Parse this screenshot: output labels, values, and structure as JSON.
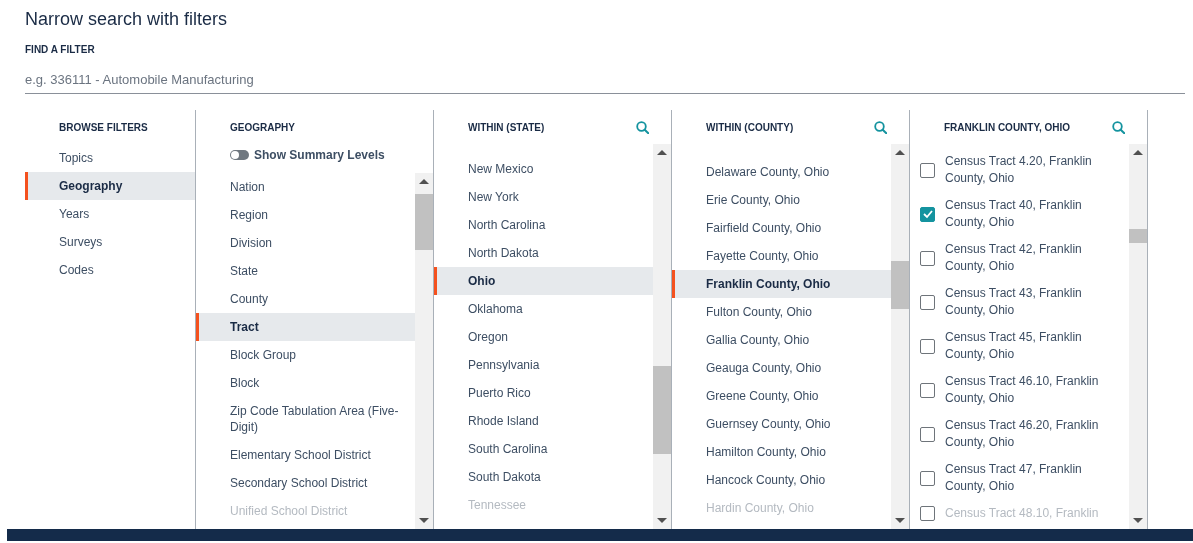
{
  "page": {
    "title": "Narrow search with filters"
  },
  "search": {
    "label": "FIND A FILTER",
    "placeholder": "e.g. 336111 - Automobile Manufacturing"
  },
  "browse": {
    "heading": "BROWSE FILTERS",
    "items": [
      {
        "label": "Topics",
        "selected": false
      },
      {
        "label": "Geography",
        "selected": true
      },
      {
        "label": "Years",
        "selected": false
      },
      {
        "label": "Surveys",
        "selected": false
      },
      {
        "label": "Codes",
        "selected": false
      }
    ]
  },
  "geography": {
    "heading": "GEOGRAPHY",
    "toggle": {
      "label": "Show Summary Levels",
      "on": false
    },
    "items": [
      {
        "label": "Nation",
        "selected": false
      },
      {
        "label": "Region",
        "selected": false
      },
      {
        "label": "Division",
        "selected": false
      },
      {
        "label": "State",
        "selected": false
      },
      {
        "label": "County",
        "selected": false
      },
      {
        "label": "Tract",
        "selected": true
      },
      {
        "label": "Block Group",
        "selected": false
      },
      {
        "label": "Block",
        "selected": false
      },
      {
        "label": "Zip Code Tabulation Area (Five-Digit)",
        "selected": false
      },
      {
        "label": "Elementary School District",
        "selected": false
      },
      {
        "label": "Secondary School District",
        "selected": false
      },
      {
        "label": "Unified School District",
        "selected": false
      }
    ]
  },
  "state": {
    "heading": "WITHIN (STATE)",
    "items": [
      {
        "label": "New Mexico",
        "selected": false
      },
      {
        "label": "New York",
        "selected": false
      },
      {
        "label": "North Carolina",
        "selected": false
      },
      {
        "label": "North Dakota",
        "selected": false
      },
      {
        "label": "Ohio",
        "selected": true
      },
      {
        "label": "Oklahoma",
        "selected": false
      },
      {
        "label": "Oregon",
        "selected": false
      },
      {
        "label": "Pennsylvania",
        "selected": false
      },
      {
        "label": "Puerto Rico",
        "selected": false
      },
      {
        "label": "Rhode Island",
        "selected": false
      },
      {
        "label": "South Carolina",
        "selected": false
      },
      {
        "label": "South Dakota",
        "selected": false
      },
      {
        "label": "Tennessee",
        "selected": false
      }
    ]
  },
  "county": {
    "heading": "WITHIN (COUNTY)",
    "items": [
      {
        "label": "Delaware County, Ohio",
        "selected": false
      },
      {
        "label": "Erie County, Ohio",
        "selected": false
      },
      {
        "label": "Fairfield County, Ohio",
        "selected": false
      },
      {
        "label": "Fayette County, Ohio",
        "selected": false
      },
      {
        "label": "Franklin County, Ohio",
        "selected": true
      },
      {
        "label": "Fulton County, Ohio",
        "selected": false
      },
      {
        "label": "Gallia County, Ohio",
        "selected": false
      },
      {
        "label": "Geauga County, Ohio",
        "selected": false
      },
      {
        "label": "Greene County, Ohio",
        "selected": false
      },
      {
        "label": "Guernsey County, Ohio",
        "selected": false
      },
      {
        "label": "Hamilton County, Ohio",
        "selected": false
      },
      {
        "label": "Hancock County, Ohio",
        "selected": false
      },
      {
        "label": "Hardin County, Ohio",
        "selected": false
      }
    ]
  },
  "tracts": {
    "heading": "FRANKLIN COUNTY, OHIO",
    "items": [
      {
        "label": "Census Tract 4.20, Franklin County, Ohio",
        "checked": false
      },
      {
        "label": "Census Tract 40, Franklin County, Ohio",
        "checked": true
      },
      {
        "label": "Census Tract 42, Franklin County, Ohio",
        "checked": false
      },
      {
        "label": "Census Tract 43, Franklin County, Ohio",
        "checked": false
      },
      {
        "label": "Census Tract 45, Franklin County, Ohio",
        "checked": false
      },
      {
        "label": "Census Tract 46.10, Franklin County, Ohio",
        "checked": false
      },
      {
        "label": "Census Tract 46.20, Franklin County, Ohio",
        "checked": false
      },
      {
        "label": "Census Tract 47, Franklin County, Ohio",
        "checked": false
      },
      {
        "label": "Census Tract 48.10, Franklin",
        "checked": false
      }
    ]
  }
}
